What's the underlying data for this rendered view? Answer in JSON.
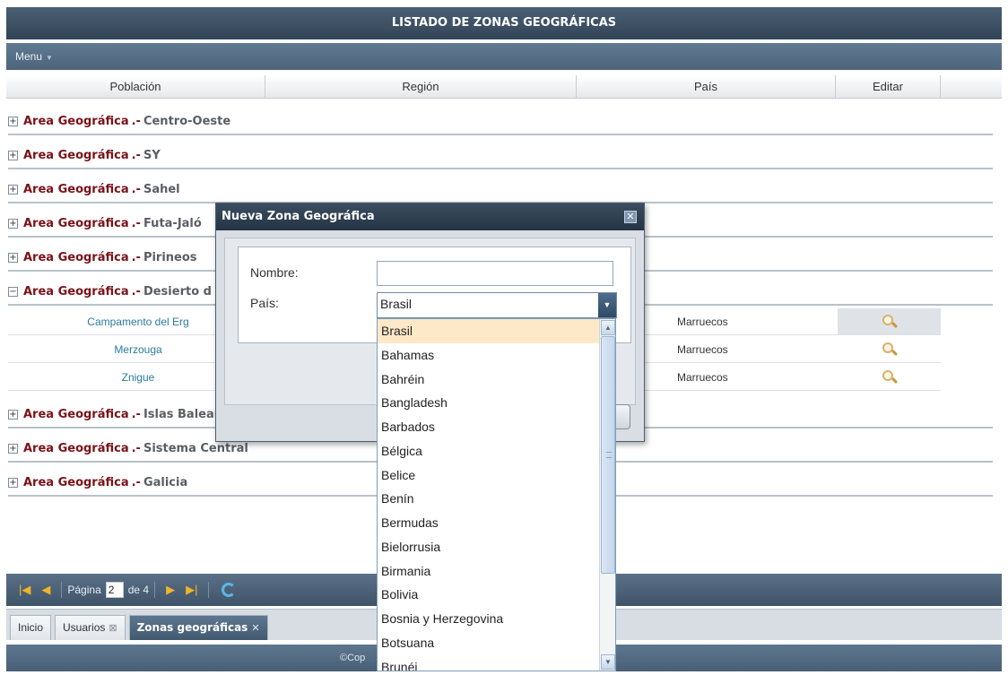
{
  "page": {
    "title": "LISTADO DE ZONAS GEOGRÁFICAS",
    "menu_label": "Menu"
  },
  "columns": [
    "Población",
    "Región",
    "País",
    "Editar"
  ],
  "groups": [
    {
      "label": "Area Geográfica",
      "sep": ".-",
      "name": "Centro-Oeste"
    },
    {
      "label": "Area Geográfica",
      "sep": ".-",
      "name": "SY"
    },
    {
      "label": "Area Geográfica",
      "sep": ".-",
      "name": "Sahel"
    },
    {
      "label": "Area Geográfica",
      "sep": ".-",
      "name": "Futa-Jaló"
    },
    {
      "label": "Area Geográfica",
      "sep": ".-",
      "name": "Pirineos"
    },
    {
      "label": "Area Geográfica",
      "sep": ".-",
      "name": "Desierto d"
    },
    {
      "label": "Area Geográfica",
      "sep": ".-",
      "name": "Islas Baleares"
    },
    {
      "label": "Area Geográfica",
      "sep": ".-",
      "name": "Sistema Central"
    },
    {
      "label": "Area Geográfica",
      "sep": ".-",
      "name": "Galicia"
    }
  ],
  "expanded_rows": [
    {
      "poblacion": "Campamento del Erg",
      "pais": "Marruecos"
    },
    {
      "poblacion": "Merzouga",
      "pais": "Marruecos"
    },
    {
      "poblacion": "Znigue",
      "pais": "Marruecos"
    }
  ],
  "pager": {
    "page_label": "Página",
    "page_value": "2",
    "of_label": "de 4"
  },
  "tabs": [
    {
      "label": "Inicio"
    },
    {
      "label": "Usuarios"
    },
    {
      "label": "Zonas geográficas"
    }
  ],
  "footer": {
    "text": "©Cop"
  },
  "dialog": {
    "title": "Nueva Zona Geográfica",
    "nombre_label": "Nombre:",
    "nombre_value": "",
    "pais_label": "País:",
    "pais_value": "Brasil"
  },
  "dropdown_options": [
    "Brasil",
    "Bahamas",
    "Bahréin",
    "Bangladesh",
    "Barbados",
    "Bélgica",
    "Belice",
    "Benín",
    "Bermudas",
    "Bielorrusia",
    "Birmania",
    "Bolivia",
    "Bosnia y Herzegovina",
    "Botsuana",
    "Brunéi"
  ],
  "colors": {
    "header_bg": "#3a4c5f",
    "group_label": "#7a1218",
    "link": "#2a7a9c",
    "selected_option": "#fde9c8"
  }
}
